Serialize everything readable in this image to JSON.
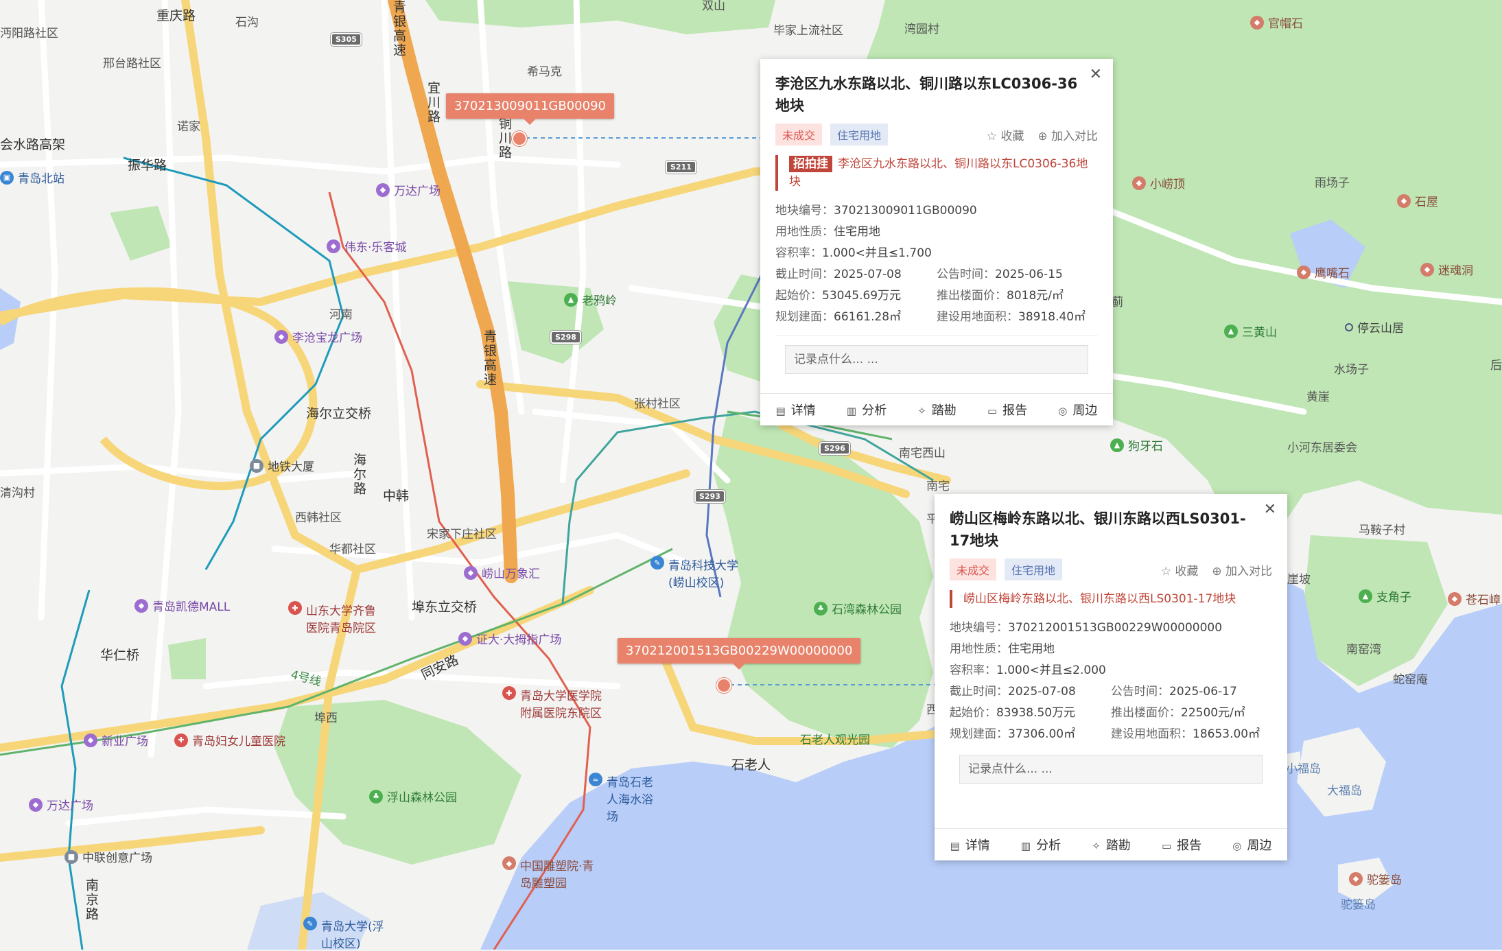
{
  "map": {
    "colors": {
      "water": "#b8cdf8",
      "green": "#bfe6b4",
      "land": "#f3f3f1",
      "highway": "#f0a850",
      "major": "#f7d67a",
      "minor": "#ffffff"
    },
    "labels": [
      {
        "id": "chongqing-road",
        "text": "重庆路"
      },
      {
        "id": "shigou",
        "text": "石沟"
      },
      {
        "id": "shuanghe",
        "text": "双山"
      },
      {
        "id": "bijia",
        "text": "毕家上流社区"
      },
      {
        "id": "wanfu",
        "text": "湾园村"
      },
      {
        "id": "heyang-road",
        "text": "沔阳路社区"
      },
      {
        "id": "xingtai-road",
        "text": "邢台路社区"
      },
      {
        "id": "ximake",
        "text": "希马克"
      },
      {
        "id": "nuojia",
        "text": "诺家"
      },
      {
        "id": "hs-road",
        "text": "会水路高架"
      },
      {
        "id": "zhenhua-road",
        "text": "振华路"
      },
      {
        "id": "yichuan-road",
        "text": "宜川路"
      },
      {
        "id": "tongchuan-road",
        "text": "铜川路"
      },
      {
        "id": "qingyin1",
        "text": "青银高速"
      },
      {
        "id": "qingyin2",
        "text": "青银高速"
      },
      {
        "id": "henan",
        "text": "河南"
      },
      {
        "id": "zhangcun",
        "text": "张村社区"
      },
      {
        "id": "haier-bridge",
        "text": "海尔立交桥"
      },
      {
        "id": "haier-road",
        "text": "海尔路"
      },
      {
        "id": "zhonghan",
        "text": "中韩"
      },
      {
        "id": "xihan",
        "text": "西韩社区"
      },
      {
        "id": "songjia",
        "text": "宋家下庄社区"
      },
      {
        "id": "huajian",
        "text": "华都社区"
      },
      {
        "id": "qinggou",
        "text": "清沟村"
      },
      {
        "id": "fudong-bridge",
        "text": "埠东立交桥"
      },
      {
        "id": "huaren-bridge",
        "text": "华仁桥"
      },
      {
        "id": "tongan-road",
        "text": "同安路"
      },
      {
        "id": "fuxi",
        "text": "埠西"
      },
      {
        "id": "line4",
        "text": "4号线"
      },
      {
        "id": "nanzhai-xishan",
        "text": "南宅西山"
      },
      {
        "id": "nanzhai",
        "text": "南宅"
      },
      {
        "id": "yuchangzi",
        "text": "雨场子"
      },
      {
        "id": "shuichangzi",
        "text": "水场子"
      },
      {
        "id": "huangya",
        "text": "黄崖"
      },
      {
        "id": "xiaohedong",
        "text": "小河东居委会"
      },
      {
        "id": "majiaocun",
        "text": "马鞍子村"
      },
      {
        "id": "yapo",
        "text": "崖坡"
      },
      {
        "id": "nanyao",
        "text": "南窑湾"
      },
      {
        "id": "sheyao",
        "text": "蛇窑庵"
      },
      {
        "id": "shilaoren",
        "text": "石老人"
      },
      {
        "id": "xiaofu",
        "text": "小福岛"
      },
      {
        "id": "dafu",
        "text": "大福岛"
      },
      {
        "id": "tuoluo2",
        "text": "驼篓岛"
      },
      {
        "id": "nanjing-road",
        "text": "南京路"
      },
      {
        "id": "ji",
        "text": "蓟"
      },
      {
        "id": "xi",
        "text": "西"
      },
      {
        "id": "ping",
        "text": "平"
      },
      {
        "id": "hou",
        "text": "后"
      }
    ],
    "shields": [
      "S305",
      "S211",
      "S298",
      "S296",
      "S293"
    ],
    "pois": [
      {
        "name": "官帽石",
        "type": "brown"
      },
      {
        "name": "青岛北站",
        "type": "blue"
      },
      {
        "name": "万达广场",
        "type": "purple"
      },
      {
        "name": "伟东·乐客城",
        "type": "purple"
      },
      {
        "name": "老鸦岭",
        "type": "green"
      },
      {
        "name": "李沧宝龙广场",
        "type": "purple"
      },
      {
        "name": "地铁大厦",
        "type": "gray"
      },
      {
        "name": "崂山万象汇",
        "type": "purple"
      },
      {
        "name": "青岛凯德MALL",
        "type": "purple"
      },
      {
        "name": "山东大学齐鲁医院青岛院区",
        "type": "red"
      },
      {
        "name": "证大·大拇指广场",
        "type": "purple"
      },
      {
        "name": "青岛科技大学(崂山校区)",
        "type": "blue"
      },
      {
        "name": "石湾森林公园",
        "type": "green"
      },
      {
        "name": "青岛大学医学院附属医院东院区",
        "type": "red"
      },
      {
        "name": "新业广场",
        "type": "purple"
      },
      {
        "name": "青岛妇女儿童医院",
        "type": "red"
      },
      {
        "name": "万达广场",
        "type": "purple"
      },
      {
        "name": "浮山森林公园",
        "type": "green"
      },
      {
        "name": "青岛石老人海水浴场",
        "type": "blue"
      },
      {
        "name": "石老人观光园",
        "type": "green"
      },
      {
        "name": "中联创意广场",
        "type": "gray"
      },
      {
        "name": "中国雕塑院·青岛雕塑园",
        "type": "brown"
      },
      {
        "name": "青岛大学(浮山校区)",
        "type": "blue"
      },
      {
        "name": "小崂顶",
        "type": "brown"
      },
      {
        "name": "石屋",
        "type": "brown"
      },
      {
        "name": "鹰嘴石",
        "type": "brown"
      },
      {
        "name": "迷魂洞",
        "type": "brown"
      },
      {
        "name": "三黄山",
        "type": "green"
      },
      {
        "name": "停云山居",
        "type": "gray"
      },
      {
        "name": "狗牙石",
        "type": "green"
      },
      {
        "name": "支角子",
        "type": "green"
      },
      {
        "name": "苍石嶂",
        "type": "brown"
      },
      {
        "name": "驼篓岛",
        "type": "brown"
      }
    ],
    "pins": [
      {
        "code": "370213009011GB00090"
      },
      {
        "code": "370212001513GB00229W00000000"
      }
    ]
  },
  "popups": [
    {
      "title": "李沧区九水东路以北、铜川路以东LC0306-36地块",
      "status": "未成交",
      "use": "住宅用地",
      "fav": "收藏",
      "compare": "加入对比",
      "auction_mark": "招拍挂",
      "auction_text": "李沧区九水东路以北、铜川路以东LC0306-36地块",
      "rows": {
        "code": {
          "k": "地块编号：",
          "v": "370213009011GB00090"
        },
        "nature": {
          "k": "用地性质：",
          "v": "住宅用地"
        },
        "far": {
          "k": "容积率：",
          "v": "1.000<并且≤1.700"
        },
        "deadline": {
          "k": "截止时间：",
          "v": "2025-07-08"
        },
        "notice": {
          "k": "公告时间：",
          "v": "2025-06-15"
        },
        "price": {
          "k": "起始价：",
          "v": "53045.69万元"
        },
        "floor": {
          "k": "推出楼面价：",
          "v": "8018元/㎡"
        },
        "plan": {
          "k": "规划建面：",
          "v": "66161.28㎡"
        },
        "area": {
          "k": "建设用地面积：",
          "v": "38918.40㎡"
        }
      },
      "note_placeholder": "记录点什么... ...",
      "bar": [
        "详情",
        "分析",
        "踏勘",
        "报告",
        "周边"
      ]
    },
    {
      "title": "崂山区梅岭东路以北、银川东路以西LS0301-17地块",
      "status": "未成交",
      "use": "住宅用地",
      "fav": "收藏",
      "compare": "加入对比",
      "auction_text": "崂山区梅岭东路以北、银川东路以西LS0301-17地块",
      "rows": {
        "code": {
          "k": "地块编号：",
          "v": "370212001513GB00229W00000000"
        },
        "nature": {
          "k": "用地性质：",
          "v": "住宅用地"
        },
        "far": {
          "k": "容积率：",
          "v": "1.000<并且≤2.000"
        },
        "deadline": {
          "k": "截止时间：",
          "v": "2025-07-08"
        },
        "notice": {
          "k": "公告时间：",
          "v": "2025-06-17"
        },
        "price": {
          "k": "起始价：",
          "v": "83938.50万元"
        },
        "floor": {
          "k": "推出楼面价：",
          "v": "22500元/㎡"
        },
        "plan": {
          "k": "规划建面：",
          "v": "37306.00㎡"
        },
        "area": {
          "k": "建设用地面积：",
          "v": "18653.00㎡"
        }
      },
      "note_placeholder": "记录点什么... ...",
      "bar": [
        "详情",
        "分析",
        "踏勘",
        "报告",
        "周边"
      ]
    }
  ]
}
